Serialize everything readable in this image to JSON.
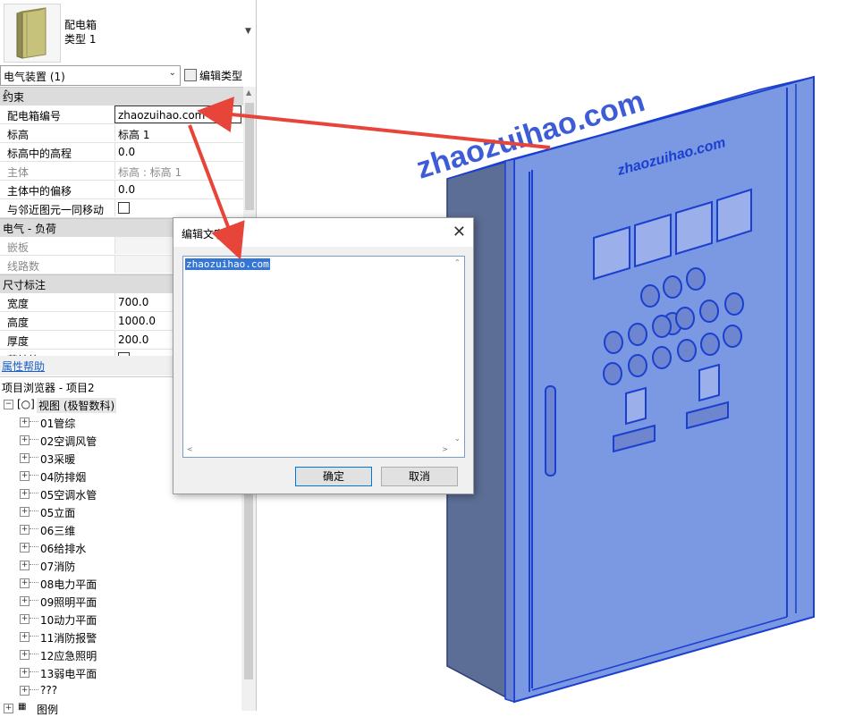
{
  "type_selector": {
    "family": "配电箱",
    "type": "类型 1"
  },
  "category": {
    "label": "电气装置 (1)",
    "edit_type": "编辑类型"
  },
  "groups": [
    {
      "title": "约束",
      "rows": [
        {
          "key": "配电箱编号",
          "value": "zhaozuihao.com"
        },
        {
          "key": "标高",
          "value": "标高 1"
        },
        {
          "key": "标高中的高程",
          "value": "0.0"
        },
        {
          "key": "主体",
          "value": "标高 : 标高 1"
        },
        {
          "key": "主体中的偏移",
          "value": "0.0"
        },
        {
          "key": "与邻近图元一同移动",
          "value": ""
        }
      ]
    },
    {
      "title": "电气 - 负荷",
      "rows": [
        {
          "key": "嵌板",
          "value": ""
        },
        {
          "key": "线路数",
          "value": ""
        }
      ]
    },
    {
      "title": "尺寸标注",
      "rows": [
        {
          "key": "宽度",
          "value": "700.0"
        },
        {
          "key": "高度",
          "value": "1000.0"
        },
        {
          "key": "厚度",
          "value": "200.0"
        },
        {
          "key": "落地箱",
          "value": ""
        }
      ]
    }
  ],
  "help_link": "属性帮助",
  "browser": {
    "title": "项目浏览器 - 项目2",
    "root": "视图 (极智数科)",
    "items": [
      "01管综",
      "02空调风管",
      "03采暖",
      "04防排烟",
      "05空调水管",
      "05立面",
      "06三维",
      "06给排水",
      "07消防",
      "08电力平面",
      "09照明平面",
      "10动力平面",
      "11消防报警",
      "12应急照明",
      "13弱电平面",
      "???"
    ],
    "next_root": "图例"
  },
  "dialog": {
    "title": "编辑文字",
    "text": "zhaozuihao.com",
    "ok": "确定",
    "cancel": "取消"
  },
  "model": {
    "watermark": "zhaozuihao.com",
    "door_text": "zhaozuihao.com",
    "colors": {
      "panel": "#7b98e3",
      "edge": "#1b3fcf",
      "arrow": "#e8453a",
      "dark_side": "#5c6e95"
    }
  }
}
